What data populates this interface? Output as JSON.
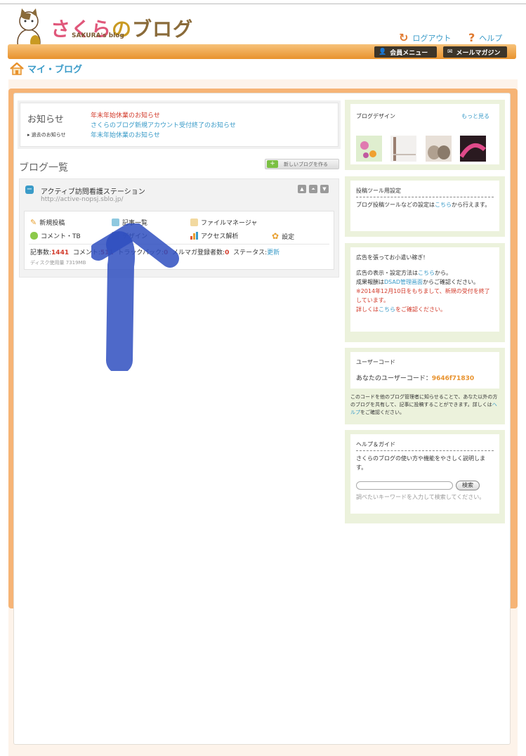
{
  "header": {
    "logo_text_a": "さくら",
    "logo_text_b": "の",
    "logo_text_c": "ブログ",
    "logo_sub": "SAKURA's blog",
    "logout_label": "ログアウト",
    "help_label": "ヘルプ",
    "member_menu_label": "会員メニュー",
    "mail_magazine_label": "メールマガジン"
  },
  "breadcrumb": {
    "title": "マイ・ブログ"
  },
  "news": {
    "title": "お知らせ",
    "past_label": "過去のお知らせ",
    "items": [
      {
        "text": "年末年始休業のお知らせ",
        "color": "#d23a2a"
      },
      {
        "text": "さくらのブログ新規アカウント受付終了のお知らせ",
        "color": "#3a9bc8"
      },
      {
        "text": "年末年始休業のお知らせ",
        "color": "#3a9bc8"
      }
    ]
  },
  "blog_list": {
    "heading": "ブログ一覧",
    "new_blog_label": "新しいブログを作る",
    "blog": {
      "name": "アクティブ訪問看護ステーション",
      "url": "http://active-nopsj.sblo.jp/",
      "menu": {
        "new_post": "新規投稿",
        "article_list": "記事一覧",
        "file_manager": "ファイルマネージャ",
        "comment_tb": "コメント・TB",
        "design": "デザイン",
        "access_analysis": "アクセス解析",
        "settings": "設定"
      },
      "stats": {
        "articles_label": "記事数:",
        "articles_value": "1441",
        "comments_label": "コメント:",
        "comments_value": "511",
        "trackback_label": "トラックバック:",
        "trackback_value": "0",
        "mailmag_label": "メルマガ登録者数:",
        "mailmag_value": "0",
        "status_label": "ステータス:",
        "status_value": "更新"
      },
      "disk_usage": "ディスク使用量 7319MB"
    }
  },
  "sidebar": {
    "design": {
      "title": "ブログデザイン",
      "more_label": "もっと見る"
    },
    "tool": {
      "title": "投稿ツール用設定",
      "text_a": "ブログ投稿ツールなどの設定は",
      "link": "こちら",
      "text_b": "から行えます。"
    },
    "ads": {
      "title": "広告を張ってお小遣い稼ぎ!",
      "line1_a": "広告の表示・設定方法は",
      "line1_link": "こちら",
      "line1_b": "から。",
      "line2_a": "成果報酬は",
      "line2_link": "DSAD管理画面",
      "line2_b": "からご確認ください。",
      "notice": "※2014年12月10日をもちまして、新規の受付を終了しています。",
      "detail_a": "詳しくは",
      "detail_link": "こちら",
      "detail_b": "をご確認ください。"
    },
    "usercode": {
      "title": "ユーザーコード",
      "label": "あなたのユーザーコード：",
      "code": "9646f71830",
      "desc_a": "このコードを他のブログ管理者に知らせることで、あなた以外の方のブログを共有して、記事に投稿することができます。詳しくは",
      "desc_link": "ヘルプ",
      "desc_b": "をご確認ください。"
    },
    "help": {
      "title": "ヘルプ＆ガイド",
      "text": "さくらのブログの使い方や機能をやさしく説明します。",
      "search_label": "検索",
      "hint": "調べたいキーワードを入力して検索してください。"
    }
  },
  "colors": {
    "accent_orange": "#e8922d",
    "link_blue": "#3a9bc8",
    "alert_red": "#d23a2a",
    "sidebar_green": "#ecf2dc",
    "arrow_blue": "#2f4fc0"
  }
}
